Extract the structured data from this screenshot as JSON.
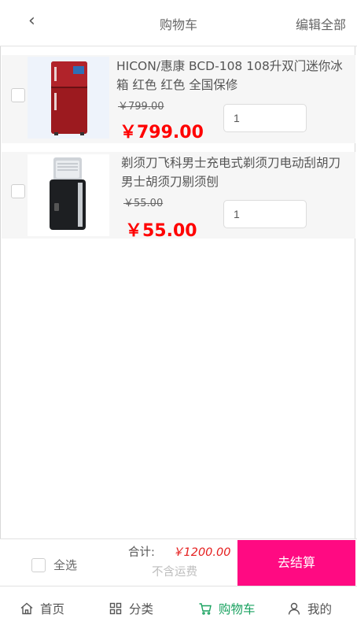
{
  "header": {
    "back_icon": "chevron-left-icon",
    "title": "购物车",
    "edit_label": "编辑全部"
  },
  "items": [
    {
      "name": "HICON/惠康 BCD-108 108升双门迷你冰箱 红色 红色 全国保修",
      "old_price": "￥799.00",
      "price": "￥799.00",
      "quantity": "1",
      "image": "red-refrigerator"
    },
    {
      "name": "剃须刀飞科男士充电式剃须刀电动刮胡刀男士胡须刀剔须刨",
      "old_price": "￥55.00",
      "price": "￥55.00",
      "quantity": "1",
      "image": "electric-shaver"
    }
  ],
  "summary": {
    "select_all_label": "全选",
    "total_label": "合计:",
    "total_value": "￥1200.00",
    "shipping_note": "不含运费",
    "checkout_label": "去结算"
  },
  "tabbar": [
    {
      "label": "首页",
      "icon": "home-icon",
      "active": false
    },
    {
      "label": "分类",
      "icon": "grid-icon",
      "active": false
    },
    {
      "label": "购物车",
      "icon": "cart-icon",
      "active": true
    },
    {
      "label": "我的",
      "icon": "user-icon",
      "active": false
    }
  ],
  "colors": {
    "accent": "#1aa260",
    "checkout": "#ff0a82",
    "price": "#ff0000"
  }
}
